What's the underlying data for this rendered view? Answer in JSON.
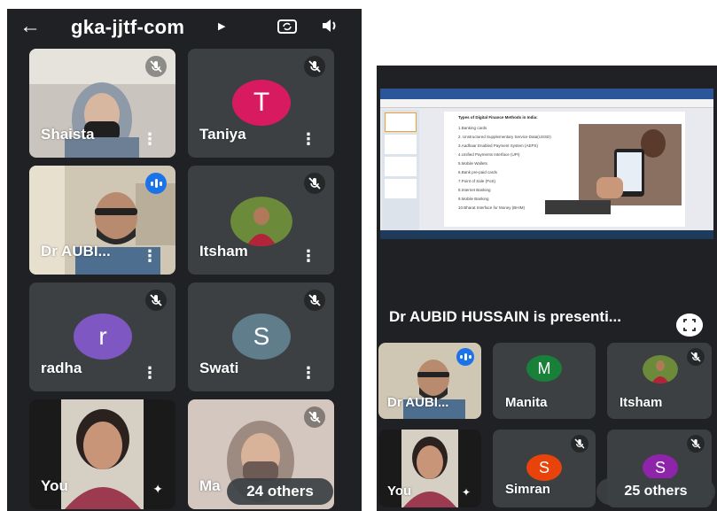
{
  "left": {
    "title": "gka-jjtf-com",
    "tiles": [
      {
        "name": "Shaista"
      },
      {
        "name": "Taniya",
        "initial": "T",
        "color": "#d81b60"
      },
      {
        "name": "Dr AUBI..."
      },
      {
        "name": "Itsham"
      },
      {
        "name": "radha",
        "initial": "r",
        "color": "#7e57c2"
      },
      {
        "name": "Swati",
        "initial": "S",
        "color": "#607d8b"
      },
      {
        "name": "You"
      },
      {
        "name": "Ma"
      }
    ],
    "others": "24 others"
  },
  "right": {
    "presenting": "Dr AUBID HUSSAIN is presenti...",
    "slide": {
      "title": "Types of Digital Finance Methods in India:",
      "items": [
        "1.Banking cards",
        "2. Unstructured Supplementary Service Data(USSD)",
        "3.Aadhaar Enabled Payment System (AEPS)",
        "4.Unified Payments Interface (UPI)",
        "5.Mobile Wallets",
        "6.Bank pre-paid cards",
        "7.Point of Sale (PoS)",
        "8.Internet Banking",
        "9.Mobile Banking",
        "10.Bharat Interface for Money (BHIM)"
      ]
    },
    "tiles": [
      {
        "name": "Dr AUBI..."
      },
      {
        "name": "Manita",
        "initial": "M",
        "color": "#188038"
      },
      {
        "name": "Itsham"
      },
      {
        "name": "You"
      },
      {
        "name": "Simran",
        "initial": "S",
        "color": "#e8430a"
      },
      {
        "name": "S",
        "initial": "S",
        "color": "#8e24aa"
      }
    ],
    "others": "25 others"
  },
  "colors": {
    "background": "#202124",
    "tile": "#3c4043",
    "speaking": "#1a73e8"
  }
}
